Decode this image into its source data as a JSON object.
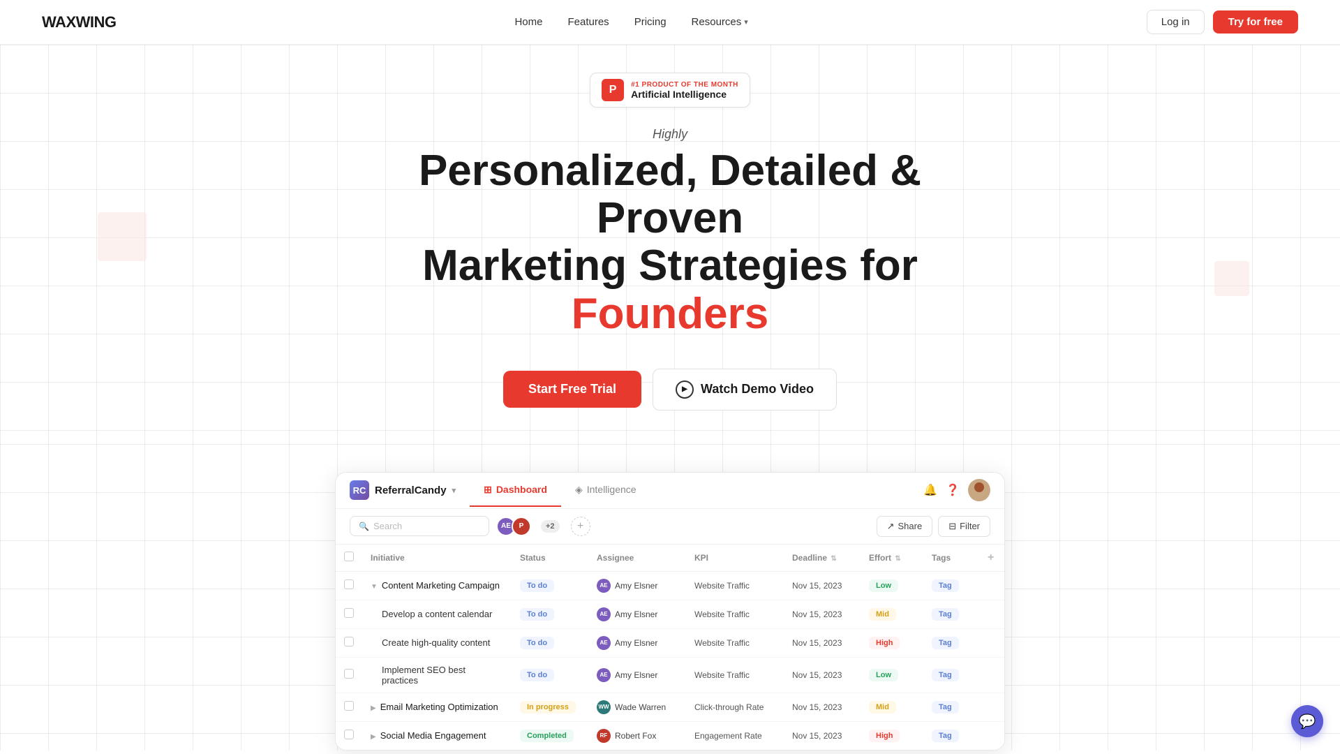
{
  "nav": {
    "logo": "WAXWING",
    "links": [
      {
        "label": "Home",
        "active": true
      },
      {
        "label": "Features"
      },
      {
        "label": "Pricing"
      },
      {
        "label": "Resources",
        "dropdown": true
      }
    ],
    "login_label": "Log in",
    "try_label": "Try for free"
  },
  "hero": {
    "ph_label": "#1 PRODUCT OF THE MONTH",
    "ph_title": "Artificial Intelligence",
    "eyebrow": "Highly",
    "heading_line1": "Personalized, Detailed & Proven",
    "heading_line2": "Marketing Strategies for",
    "heading_accent": "Founders",
    "cta_primary": "Start Free Trial",
    "cta_secondary": "Watch Demo Video"
  },
  "dashboard": {
    "brand": "ReferralCandy",
    "tabs": [
      {
        "label": "Dashboard",
        "icon": "⊞",
        "active": true
      },
      {
        "label": "Intelligence",
        "icon": "◈"
      }
    ],
    "search_placeholder": "Search",
    "avatar_extras": "+2",
    "share_label": "Share",
    "filter_label": "Filter",
    "columns": [
      {
        "label": "Initiative"
      },
      {
        "label": "Status"
      },
      {
        "label": "Assignee"
      },
      {
        "label": "KPI"
      },
      {
        "label": "Deadline",
        "sortable": true
      },
      {
        "label": "Effort",
        "sortable": true
      },
      {
        "label": "Tags"
      }
    ],
    "rows": [
      {
        "id": "row1",
        "indent": 0,
        "expanded": true,
        "initiative": "Content Marketing Campaign",
        "status": "To do",
        "status_type": "todo",
        "assignee": "Amy Elsner",
        "assignee_color": "#7c5cbf",
        "kpi": "Website Traffic",
        "deadline": "Nov 15, 2023",
        "effort": "Low",
        "effort_type": "low",
        "tag": "Tag"
      },
      {
        "id": "row2",
        "indent": 1,
        "initiative": "Develop a content calendar",
        "status": "To do",
        "status_type": "todo",
        "assignee": "Amy Elsner",
        "assignee_color": "#7c5cbf",
        "kpi": "Website Traffic",
        "deadline": "Nov 15, 2023",
        "effort": "Mid",
        "effort_type": "mid",
        "tag": "Tag"
      },
      {
        "id": "row3",
        "indent": 1,
        "initiative": "Create high-quality content",
        "status": "To do",
        "status_type": "todo",
        "assignee": "Amy Elsner",
        "assignee_color": "#7c5cbf",
        "kpi": "Website Traffic",
        "deadline": "Nov 15, 2023",
        "effort": "High",
        "effort_type": "high",
        "tag": "Tag"
      },
      {
        "id": "row4",
        "indent": 1,
        "initiative": "Implement SEO best practices",
        "status": "To do",
        "status_type": "todo",
        "assignee": "Amy Elsner",
        "assignee_color": "#7c5cbf",
        "kpi": "Website Traffic",
        "deadline": "Nov 15, 2023",
        "effort": "Low",
        "effort_type": "low",
        "tag": "Tag"
      },
      {
        "id": "row5",
        "indent": 0,
        "collapsed": true,
        "initiative": "Email Marketing Optimization",
        "status": "In progress",
        "status_type": "inprogress",
        "assignee": "Wade Warren",
        "assignee_color": "#2b7a78",
        "kpi": "Click-through Rate",
        "deadline": "Nov 15, 2023",
        "effort": "Mid",
        "effort_type": "mid",
        "tag": "Tag"
      },
      {
        "id": "row6",
        "indent": 0,
        "collapsed": true,
        "initiative": "Social Media Engagement",
        "status": "Completed",
        "status_type": "completed",
        "assignee": "Robert Fox",
        "assignee_color": "#c0392b",
        "kpi": "Engagement Rate",
        "deadline": "Nov 15, 2023",
        "effort": "High",
        "effort_type": "high",
        "tag": "Tag"
      }
    ]
  }
}
